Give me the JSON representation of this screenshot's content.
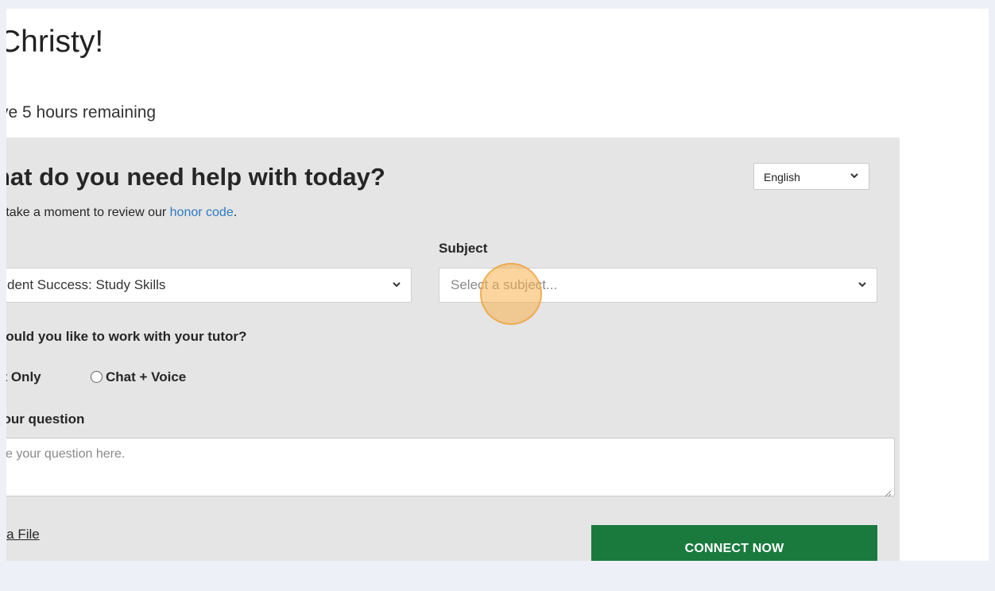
{
  "greeting": "Christy!",
  "hours_remaining": "ve 5 hours remaining",
  "panel": {
    "heading": "hat do you need help with today?",
    "language": {
      "selected": "English"
    },
    "honor_text": "e take a moment to review our ",
    "honor_link": "honor code",
    "honor_suffix": ".",
    "topic_value": "dent Success: Study Skills",
    "subject_label": "Subject",
    "subject_placeholder": "Select a subject...",
    "work_question": "would you like to work with your tutor?",
    "options": {
      "chat_only": "at Only",
      "chat_voice": "Chat + Voice"
    },
    "question_label": "your question",
    "question_placeholder": "e your question here.",
    "attach_label": "h a File",
    "connect_label": "CONNECT NOW"
  },
  "colors": {
    "page_bg": "#eef0f7",
    "panel_bg": "#e5e5e5",
    "link": "#2f7bbf",
    "connect_button": "#1a7a3e",
    "click_indicator": "#f7b04e"
  },
  "icons": {
    "dropdown": "chevron-down-icon",
    "resize": "resize-grip-icon"
  }
}
